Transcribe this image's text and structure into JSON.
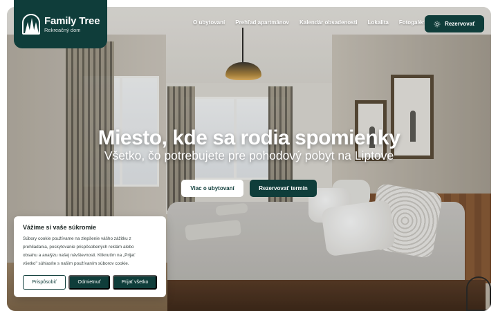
{
  "brand": {
    "title": "Family Tree",
    "subtitle": "Rekreačný dom"
  },
  "nav": {
    "items": [
      "O ubytovaní",
      "Prehľad apartmánov",
      "Kalendár obsadenosti",
      "Lokalita",
      "Fotogaléria"
    ],
    "reserve_label": "Rezervovať",
    "reserve_icon": "sun-icon"
  },
  "hero": {
    "title": "Miesto, kde sa rodia spomienky",
    "subtitle": "Všetko, čo potrebujete pre pohodový pobyt na Liptove",
    "primary_button": "Viac o ubytovaní",
    "secondary_button": "Rezervovať termín"
  },
  "cookie": {
    "title": "Vážime si vaše súkromie",
    "lines": [
      "Súbory cookie používame na zlepšenie vášho zážitku z",
      "prehliadania, poskytovanie prispôsobených reklám alebo",
      "obsahu a analýzu našej návštevnosti. Kliknutím na „Prijať",
      "všetko\" súhlasíte s naším používaním súborov cookie."
    ],
    "customize": "Prispôsobiť",
    "reject": "Odmietnuť",
    "accept": "Prijať všetko"
  },
  "colors": {
    "brand_dark": "#0f3d3a",
    "white": "#ffffff"
  }
}
